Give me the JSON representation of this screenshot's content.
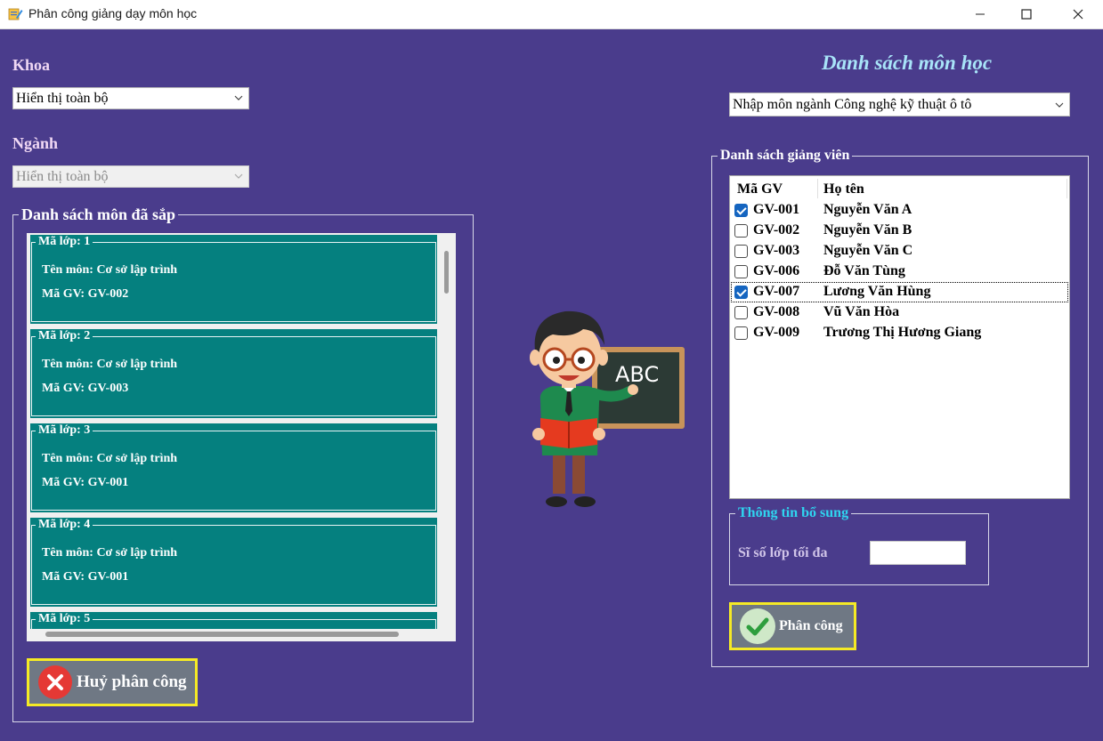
{
  "window": {
    "title": "Phân công giảng dạy môn học"
  },
  "left": {
    "khoa_label": "Khoa",
    "khoa_value": "Hiển thị toàn bộ",
    "nganh_label": "Ngành",
    "nganh_value": "Hiển thị toàn bộ",
    "assigned_group_title": "Danh sách môn đã sắp",
    "classes": [
      {
        "legend": "Mã lớp: 1",
        "subject": "Tên môn: Cơ sở lập trình",
        "teacher": "Mã GV: GV-002"
      },
      {
        "legend": "Mã lớp: 2",
        "subject": "Tên môn: Cơ sở lập trình",
        "teacher": "Mã GV: GV-003"
      },
      {
        "legend": "Mã lớp: 3",
        "subject": "Tên môn: Cơ sở lập trình",
        "teacher": "Mã GV: GV-001"
      },
      {
        "legend": "Mã lớp: 4",
        "subject": "Tên môn: Cơ sở lập trình",
        "teacher": "Mã GV: GV-001"
      },
      {
        "legend": "Mã lớp: 5",
        "subject": "",
        "teacher": ""
      }
    ],
    "cancel_button": "Huỷ phân công"
  },
  "illustration": {
    "board_text": "ABC"
  },
  "right": {
    "subject_list_title": "Danh sách môn học",
    "subject_value": "Nhập môn ngành Công nghệ kỹ thuật ô tô",
    "teacher_group_title": "Danh sách giảng viên",
    "columns": [
      "Mã GV",
      "Họ tên"
    ],
    "teachers": [
      {
        "id": "GV-001",
        "name": "Nguyễn Văn A",
        "checked": true,
        "selected": false
      },
      {
        "id": "GV-002",
        "name": "Nguyễn Văn B",
        "checked": false,
        "selected": false
      },
      {
        "id": "GV-003",
        "name": "Nguyễn Văn C",
        "checked": false,
        "selected": false
      },
      {
        "id": "GV-006",
        "name": "Đỗ Văn Tùng",
        "checked": false,
        "selected": false
      },
      {
        "id": "GV-007",
        "name": "Lương Văn Hùng",
        "checked": true,
        "selected": true
      },
      {
        "id": "GV-008",
        "name": "Vũ Văn Hòa",
        "checked": false,
        "selected": false
      },
      {
        "id": "GV-009",
        "name": "Trương Thị Hương Giang",
        "checked": false,
        "selected": false
      }
    ],
    "extra_group_title": "Thông tin bổ sung",
    "max_size_label": "Sĩ số lớp tối đa",
    "max_size_value": "",
    "assign_button": "Phân công"
  },
  "colors": {
    "background": "#4a3c8c",
    "card": "#05807f",
    "button_border": "#f5ea25",
    "button_fill": "#6f7884",
    "title_cyan": "#a8e4f8",
    "extra_title": "#2fd5f0",
    "checkbox": "#1565c0"
  }
}
